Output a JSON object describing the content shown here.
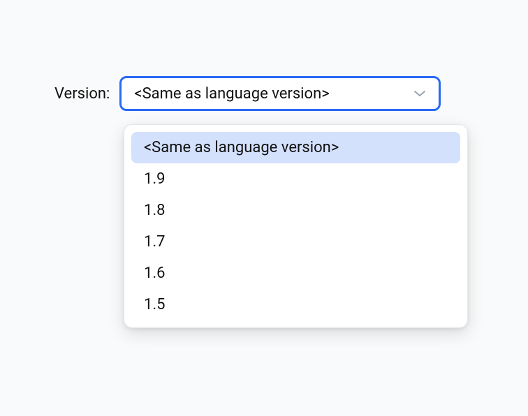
{
  "field": {
    "label": "Version:",
    "selected_value": "<Same as language version>",
    "options": [
      {
        "label": "<Same as language version>",
        "selected": true
      },
      {
        "label": "1.9",
        "selected": false
      },
      {
        "label": "1.8",
        "selected": false
      },
      {
        "label": "1.7",
        "selected": false
      },
      {
        "label": "1.6",
        "selected": false
      },
      {
        "label": "1.5",
        "selected": false
      }
    ]
  }
}
